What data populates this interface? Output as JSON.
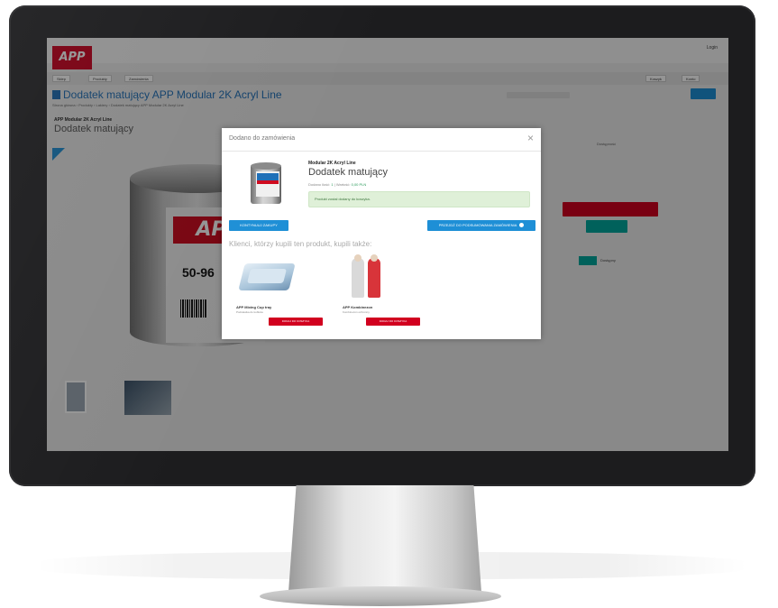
{
  "header": {
    "logo_text": "APP",
    "user_link": "Login",
    "nav_items": [
      "Sklep",
      "Produkty",
      "Zamówienia"
    ],
    "nav_right": [
      "Koszyk",
      "Konto"
    ]
  },
  "page": {
    "title": "Dodatek matujący APP Modular 2K Acryl Line",
    "breadcrumb": "Strona główna › Produkty › Lakiery › Dodatek matujący APP Modular 2K Acryl Line",
    "product_line": "APP Modular 2K Acryl Line",
    "product_name": "Dodatek matujący",
    "can_brand": "APP",
    "can_code": "50-96"
  },
  "modal": {
    "title": "Dodano do zamówienia",
    "close_symbol": "×",
    "item": {
      "line": "Modular 2K Acryl Line",
      "name": "Dodatek matujący",
      "meta_prefix": "Dodano ilość: ",
      "meta_qty": "1",
      "meta_mid": "  |  Wartość: ",
      "meta_value": "0,00 PLN"
    },
    "success_message": "Produkt został dodany do koszyka.",
    "continue_button": "KONTYNUUJ ZAKUPY",
    "checkout_button": "PRZEJDŹ DO PODSUMOWANIA ZAMÓWIENIA",
    "recommend_heading": "Klienci, którzy kupili ten produkt, kupili także:",
    "recommendations": [
      {
        "name": "APP Mixing Cup tray",
        "desc": "Podstawka do kubków",
        "button": "DODAJ DO KOSZYKA"
      },
      {
        "name": "APP Kombinezon",
        "desc": "Kombinezon ochronny",
        "button": "DODAJ DO KOSZYKA"
      }
    ]
  },
  "sidebar_right": {
    "label": "Dostępność",
    "small_text": "Dostępny"
  },
  "colors": {
    "brand_red": "#d1001f",
    "brand_blue": "#1e8fd6",
    "success_bg": "#dff0d8",
    "teal": "#00a79d"
  },
  "icons": [
    "close-icon",
    "document-icon",
    "arrow-right-icon"
  ]
}
